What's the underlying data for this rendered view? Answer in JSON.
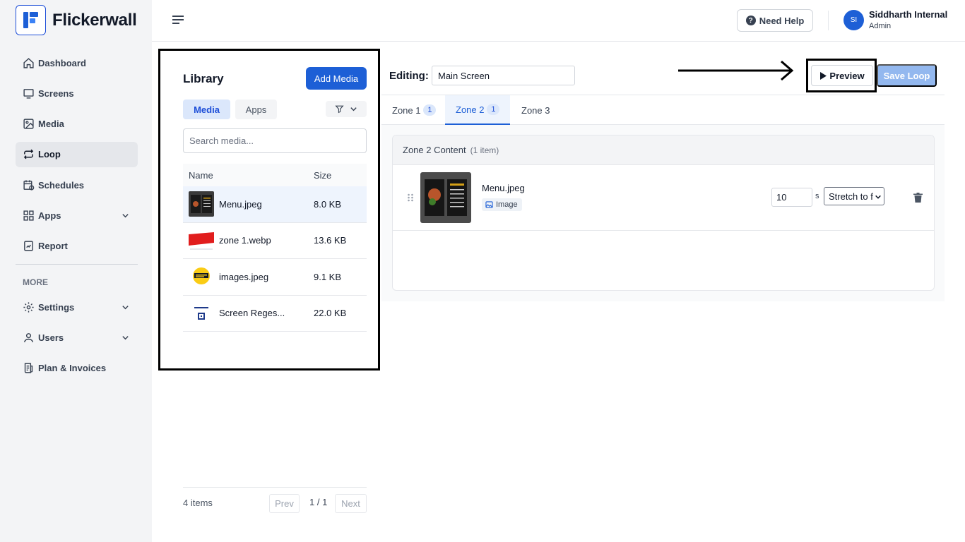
{
  "brand": {
    "name": "Flickerwall"
  },
  "sidebar": {
    "items": [
      {
        "label": "Dashboard",
        "icon": "home-icon"
      },
      {
        "label": "Screens",
        "icon": "monitor-icon"
      },
      {
        "label": "Media",
        "icon": "image-icon"
      },
      {
        "label": "Loop",
        "icon": "loop-icon",
        "active": true
      },
      {
        "label": "Schedules",
        "icon": "calendar-icon"
      },
      {
        "label": "Apps",
        "icon": "apps-icon",
        "expandable": true
      },
      {
        "label": "Report",
        "icon": "report-icon"
      }
    ],
    "section_label": "MORE",
    "more_items": [
      {
        "label": "Settings",
        "icon": "gear-icon",
        "expandable": true
      },
      {
        "label": "Users",
        "icon": "user-icon",
        "expandable": true
      },
      {
        "label": "Plan & Invoices",
        "icon": "invoice-icon"
      }
    ]
  },
  "topbar": {
    "help_label": "Need Help",
    "user": {
      "initials": "SI",
      "name": "Siddharth Internal",
      "role": "Admin"
    }
  },
  "library": {
    "title": "Library",
    "add_label": "Add Media",
    "tabs": [
      "Media",
      "Apps"
    ],
    "active_tab": "Media",
    "search_placeholder": "Search media...",
    "columns": [
      "Name",
      "Size"
    ],
    "rows": [
      {
        "name": "Menu.jpeg",
        "size": "8.0 KB",
        "selected": true
      },
      {
        "name": "zone 1.webp",
        "size": "13.6 KB"
      },
      {
        "name": "images.jpeg",
        "size": "9.1 KB"
      },
      {
        "name": "Screen Reges...",
        "size": "22.0 KB"
      }
    ],
    "footer": {
      "count": "4 items",
      "prev": "Prev",
      "page": "1 / 1",
      "next": "Next"
    }
  },
  "editor": {
    "label": "Editing:",
    "screen_name": "Main Screen",
    "preview_label": "Preview",
    "save_label": "Save Loop",
    "zones": [
      {
        "label": "Zone 1",
        "count": "1"
      },
      {
        "label": "Zone 2",
        "count": "1",
        "active": true
      },
      {
        "label": "Zone 3"
      }
    ],
    "zone_content": {
      "title": "Zone 2 Content",
      "subtitle": "(1 item)",
      "items": [
        {
          "name": "Menu.jpeg",
          "type": "Image",
          "duration": "10",
          "unit": "s",
          "fit": "Stretch to f"
        }
      ]
    }
  },
  "colors": {
    "accent": "#1d5fd6",
    "annotation": "#000000"
  }
}
